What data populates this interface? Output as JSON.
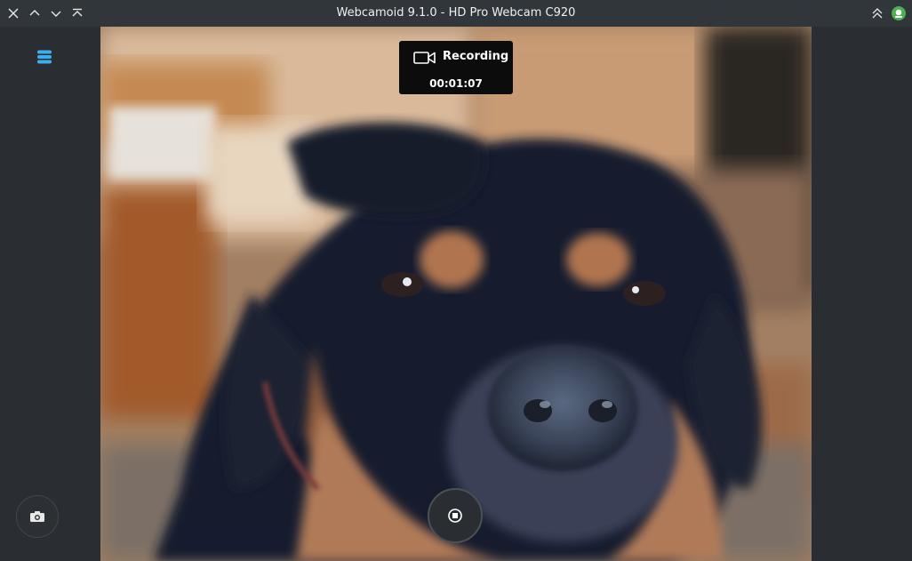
{
  "window": {
    "title": "Webcamoid 9.1.0 - HD Pro Webcam C920",
    "controls": [
      "close",
      "maximize",
      "minimize",
      "keep-above"
    ]
  },
  "recording": {
    "status_label": "Recording",
    "elapsed": "00:01:07"
  },
  "sidebar": {
    "menu_icon": "hamburger-menu-icon",
    "photo_button_icon": "camera-icon"
  },
  "controls": {
    "stop_button_icon": "stop-icon"
  },
  "colors": {
    "accent": "#3daee9",
    "titlebar": "#31363b",
    "background": "#2a2e32",
    "tray_icon": "#4caf50"
  }
}
